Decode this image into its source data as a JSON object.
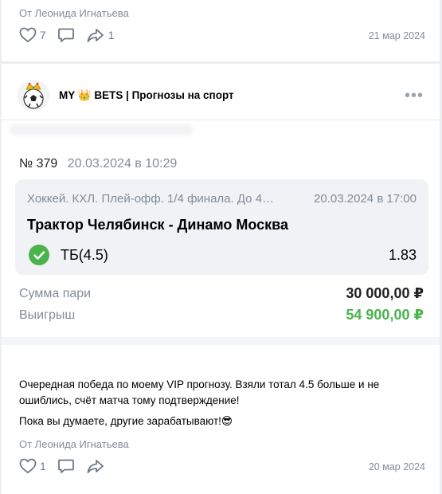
{
  "top_post": {
    "author_line": "От Леонида Игнатьева",
    "likes": "7",
    "shares": "1",
    "date": "21 мар 2024"
  },
  "main_post": {
    "group_name": "MY 👑 BETS | Прогнозы на спорт",
    "more_label": "•••",
    "bet": {
      "number": "№ 379",
      "placed_at": "20.03.2024 в 10:29",
      "league": "Хоккей. КХЛ. Плей-офф. 1/4 финала. До 4…",
      "event_date": "20.03.2024 в 17:00",
      "teams": "Трактор Челябинск - Динамо Москва",
      "bet_type": "ТБ(4.5)",
      "coefficient": "1.83",
      "stake_label": "Сумма пари",
      "stake_value": "30 000,00 ₽",
      "win_label": "Выигрыш",
      "win_value": "54 900,00 ₽"
    },
    "text_p1": "Очередная победа по моему VIP прогнозу. Взяли тотал 4.5 больше и не ошиблись, счёт матча тому подтверждение!",
    "text_p2": "Пока вы думаете, другие зарабатывают!😎",
    "author_line": "От Леонида Игнатьева",
    "likes": "1",
    "date": "20 мар 2024"
  },
  "colors": {
    "win_green": "#4bb34b",
    "muted": "#818c99",
    "box_bg": "#f0f2f5"
  }
}
